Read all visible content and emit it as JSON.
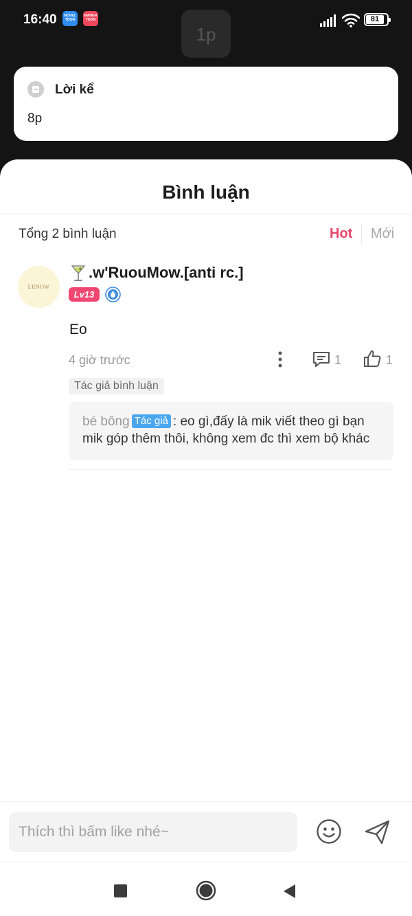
{
  "status_bar": {
    "time": "16:40",
    "app_badges": [
      "NOVEL TOON",
      "MANGA TOON"
    ],
    "battery": "81"
  },
  "page_chip": "1p",
  "narration": {
    "icon": "message-bubble-icon",
    "title": "Lời kể",
    "text": "8p"
  },
  "comments": {
    "title": "Bình luận",
    "total": "Tổng 2 bình luận",
    "sort": {
      "hot": "Hot",
      "new": "Mới"
    },
    "items": [
      {
        "avatar_text": "LRNOW",
        "username": ".w'RuouMow.[anti rc.]",
        "level": "Lv13",
        "text": "Eo",
        "time": "4 giờ trước",
        "reply_count": "1",
        "like_count": "1",
        "tag": "Tác giả bình luận",
        "reply": {
          "name": "bé bông",
          "badge": "Tác giả",
          "line1": ": eo gì,đấy là mik viết theo gì bạn",
          "line2": "mik góp thêm thôi, không xem đc thì xem bộ khác"
        }
      }
    ]
  },
  "input": {
    "placeholder": "Thích thì bấm like nhé~"
  },
  "colors": {
    "accent_hot": "#e8466a",
    "level_badge": "#ef4772",
    "author_badge": "#4ba6ee"
  }
}
